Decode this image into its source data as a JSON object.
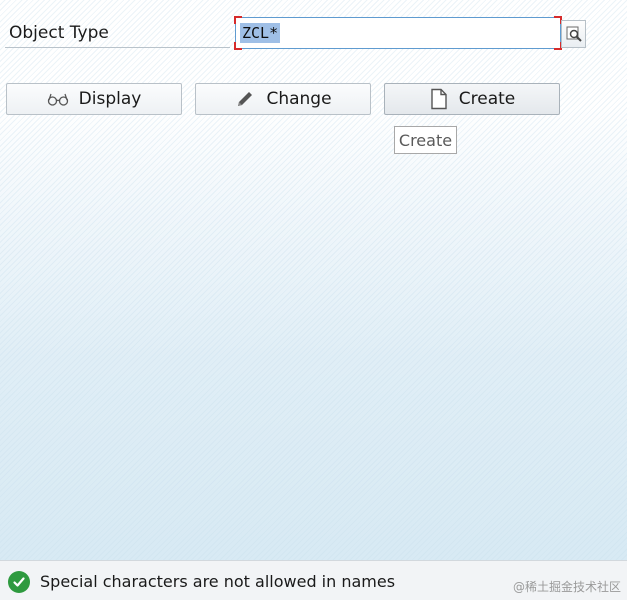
{
  "form": {
    "object_type_label": "Object Type",
    "object_type_value": "ZCL*"
  },
  "icons": {
    "value_help": "magnifier-icon",
    "display": "glasses-icon",
    "change": "pencil-icon",
    "create": "document-icon",
    "status": "check-circle-icon"
  },
  "buttons": {
    "display_label": "Display",
    "change_label": "Change",
    "create_label": "Create"
  },
  "tooltip": {
    "text": "Create"
  },
  "status_bar": {
    "message": "Special characters are not allowed in names",
    "type": "success",
    "color": "#2e9a3f"
  },
  "watermark": "@稀土掘金技术社区"
}
